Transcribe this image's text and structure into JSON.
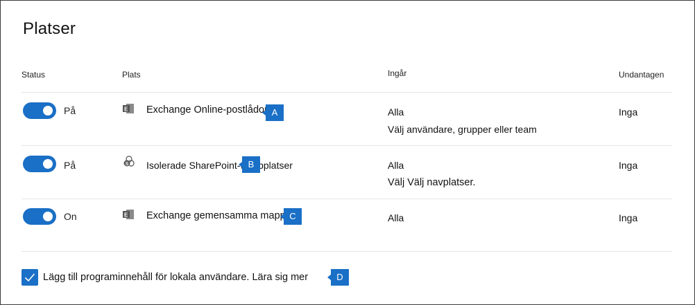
{
  "page": {
    "title": "Platser"
  },
  "columns": {
    "status": "Status",
    "location": "Plats",
    "included": "Ingår",
    "excluded": "Undantagen"
  },
  "rows": [
    {
      "toggle_label": "På",
      "icon": "exchange-icon",
      "name": "Exchange Online-postlådor",
      "callout": "A",
      "included": "Alla",
      "include_link": "Välj användare, grupper eller team",
      "excluded": "Inga"
    },
    {
      "toggle_label": "På",
      "icon": "sharepoint-icon",
      "name": "Isolerade SharePoint-webbplatser",
      "callout": "B",
      "included": "Alla",
      "include_link": "Välj Välj navplatser.",
      "excluded": "Inga"
    },
    {
      "toggle_label": "On",
      "icon": "exchange-icon",
      "name": "Exchange gemensamma mappar",
      "callout": "C",
      "included": "Alla",
      "include_link": "",
      "excluded": "Inga"
    }
  ],
  "footer": {
    "checkbox_label": "Lägg till programinnehåll för lokala användare. Lära sig mer",
    "callout": "D"
  },
  "colors": {
    "accent": "#1a6fc6"
  }
}
